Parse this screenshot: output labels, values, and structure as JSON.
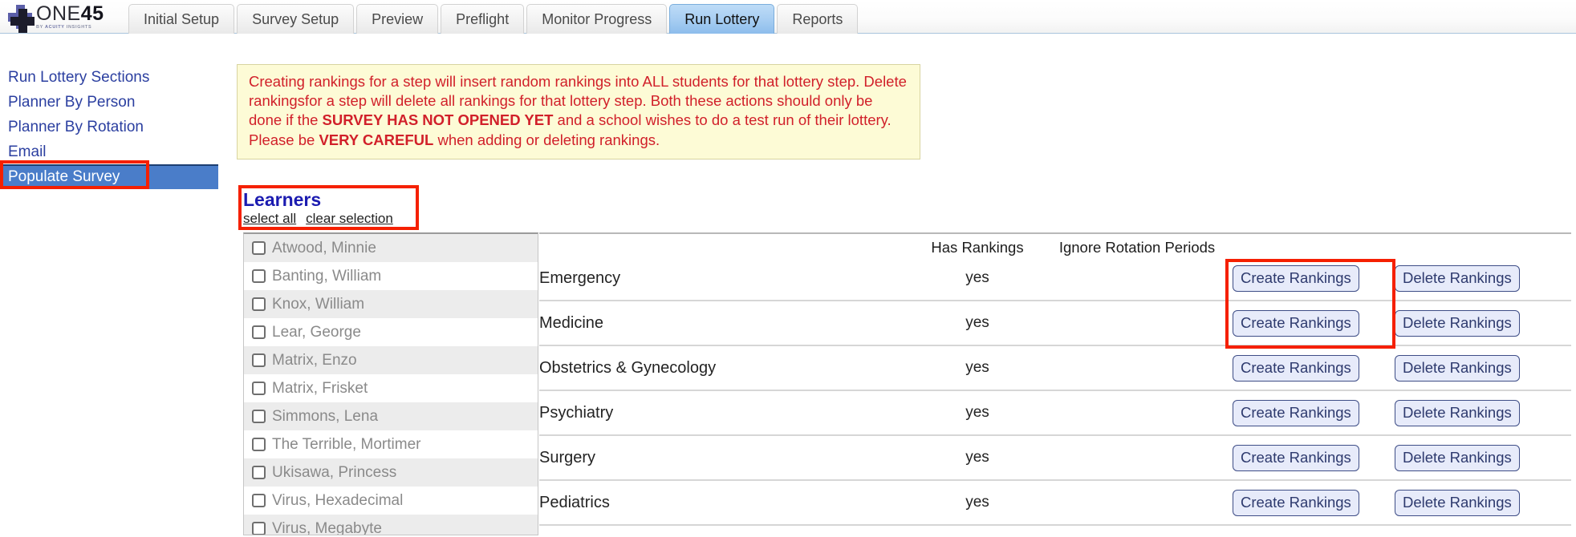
{
  "brand": {
    "word_light": "ONE",
    "word_bold": "45",
    "tagline_prefix": "BY ",
    "tagline_mid": "ACUITY ",
    "tagline_suffix": "INSIGHTS"
  },
  "tabs": [
    {
      "label": "Initial Setup",
      "active": false
    },
    {
      "label": "Survey Setup",
      "active": false
    },
    {
      "label": "Preview",
      "active": false
    },
    {
      "label": "Preflight",
      "active": false
    },
    {
      "label": "Monitor Progress",
      "active": false
    },
    {
      "label": "Run Lottery",
      "active": true
    },
    {
      "label": "Reports",
      "active": false
    }
  ],
  "sidebar": {
    "items": [
      {
        "label": "Run Lottery Sections",
        "selected": false
      },
      {
        "label": "Planner By Person",
        "selected": false
      },
      {
        "label": "Planner By Rotation",
        "selected": false
      },
      {
        "label": "Email",
        "selected": false
      },
      {
        "label": "Populate Survey",
        "selected": true
      }
    ]
  },
  "warning": {
    "seg1": "Creating rankings for a step will insert random rankings into ALL students for that lottery step. Delete rankingsfor a step will delete all rankings for that lottery step. Both these actions should only be done if the ",
    "bold1": "SURVEY HAS NOT OPENED YET",
    "seg2": " and a school wishes to do a test run of their lottery. Please be ",
    "bold2": "VERY CAREFUL",
    "seg3": " when adding or deleting rankings."
  },
  "learners": {
    "title": "Learners",
    "select_all": "select all",
    "clear_selection": "clear selection",
    "items": [
      {
        "name": "Atwood, Minnie",
        "checked": false
      },
      {
        "name": "Banting, William",
        "checked": false
      },
      {
        "name": "Knox, William",
        "checked": false
      },
      {
        "name": "Lear, George",
        "checked": false
      },
      {
        "name": "Matrix, Enzo",
        "checked": false
      },
      {
        "name": "Matrix, Frisket",
        "checked": false
      },
      {
        "name": "Simmons, Lena",
        "checked": false
      },
      {
        "name": "The Terrible, Mortimer",
        "checked": false
      },
      {
        "name": "Ukisawa, Princess",
        "checked": false
      },
      {
        "name": "Virus, Hexadecimal",
        "checked": false
      },
      {
        "name": "Virus, Megabyte",
        "checked": false
      }
    ]
  },
  "rotations": {
    "headers": {
      "name": "",
      "has_rankings": "Has Rankings",
      "ignore_rotation_periods": "Ignore Rotation Periods"
    },
    "create_label": "Create Rankings",
    "delete_label": "Delete Rankings",
    "rows": [
      {
        "name": "Emergency",
        "has_rankings": "yes"
      },
      {
        "name": "Medicine",
        "has_rankings": "yes"
      },
      {
        "name": "Obstetrics & Gynecology",
        "has_rankings": "yes"
      },
      {
        "name": "Psychiatry",
        "has_rankings": "yes"
      },
      {
        "name": "Surgery",
        "has_rankings": "yes"
      },
      {
        "name": "Pediatrics",
        "has_rankings": "yes"
      }
    ]
  },
  "colors": {
    "annotation_red": "#f52000",
    "active_tab_blue": "#a8cef2",
    "warning_bg": "#fdfbd6",
    "warning_text": "#d1202a",
    "sidebar_link": "#2b3fa0",
    "sidebar_selected_bg": "#4a7dc9",
    "button_text": "#2e3a6e",
    "button_bg": "#e7ebfa"
  }
}
